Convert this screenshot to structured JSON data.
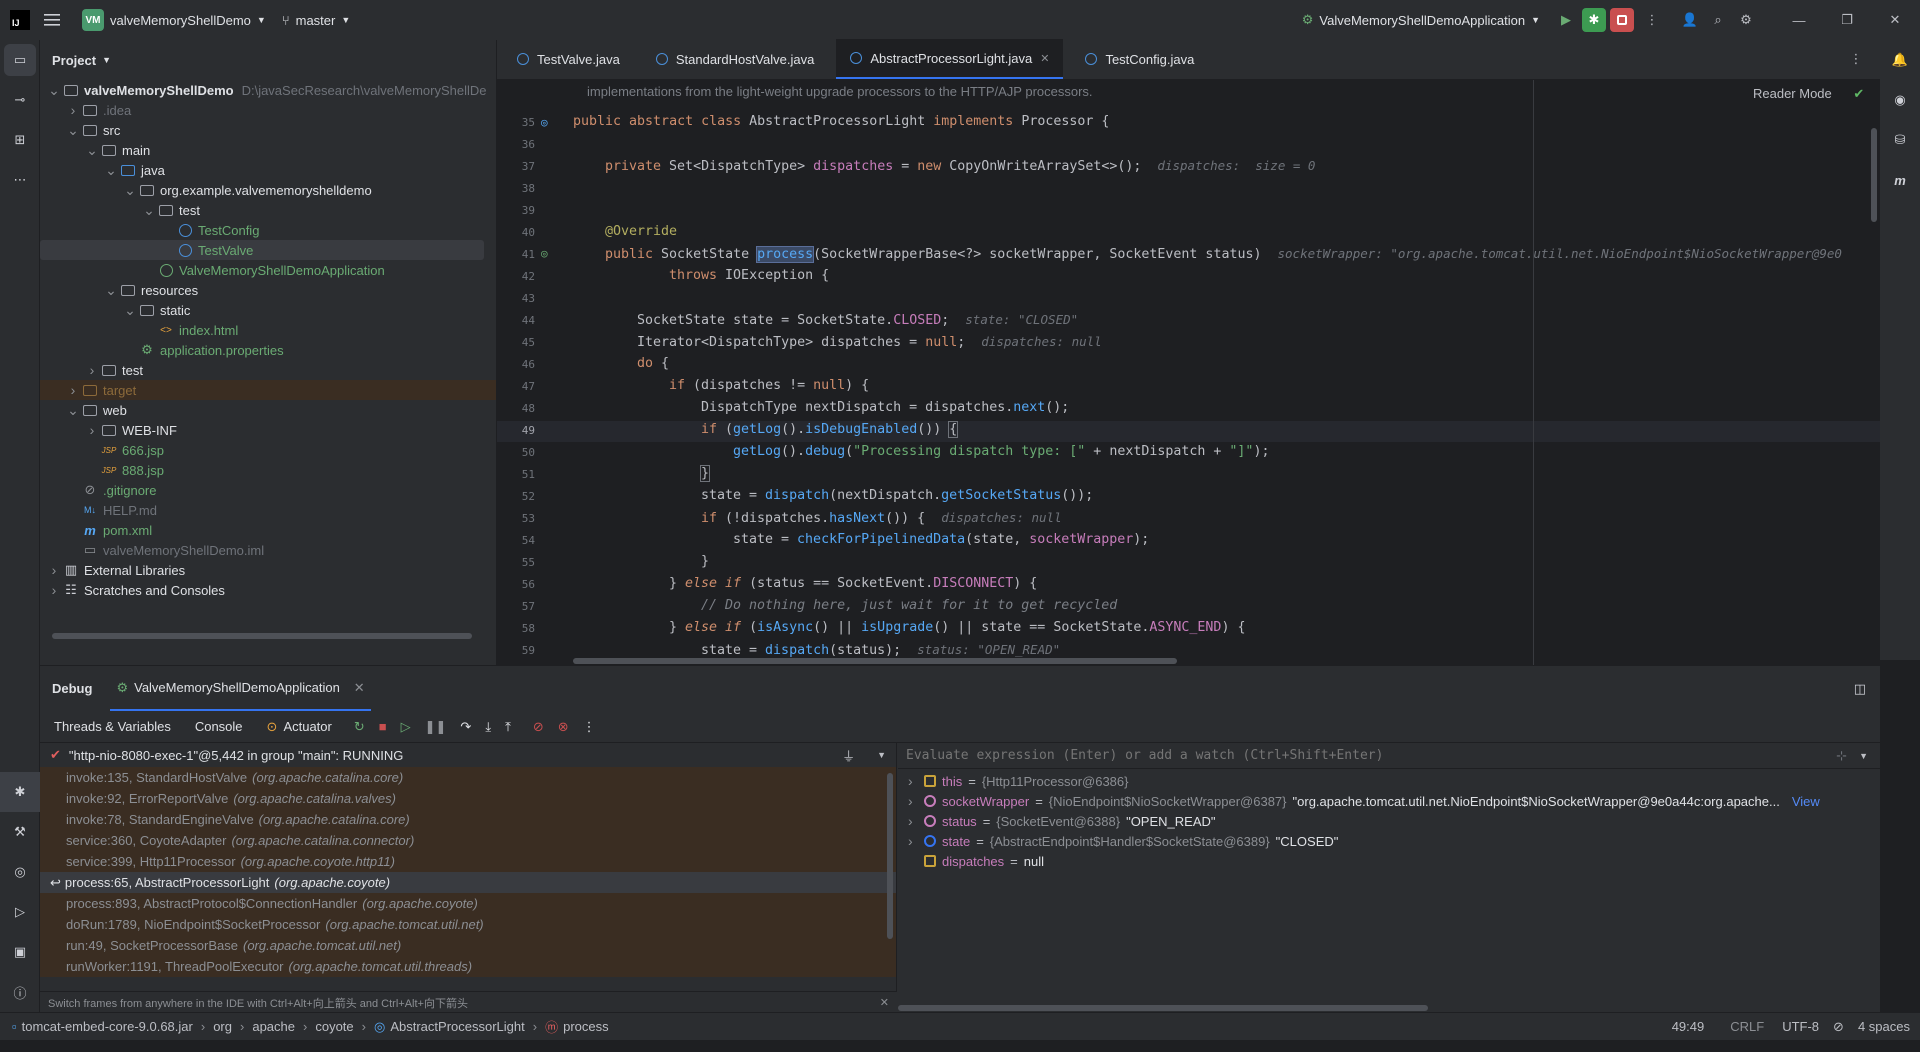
{
  "titlebar": {
    "ide_logo": "IJ",
    "project_badge": "VM",
    "project_name": "valveMemoryShellDemo",
    "branch": "master",
    "run_config": "ValveMemoryShellDemoApplication"
  },
  "project_panel": {
    "title": "Project",
    "tree": [
      {
        "label": "valveMemoryShellDemo",
        "extra": "D:\\javaSecResearch\\valveMemoryShellDe",
        "depth": 0,
        "open": true,
        "icon": "folder-icon",
        "color": "#dfe1e5",
        "bold": true
      },
      {
        "label": ".idea",
        "depth": 1,
        "open": false,
        "icon": "folder-icon",
        "color": "#6f737a"
      },
      {
        "label": "src",
        "depth": 1,
        "open": true,
        "icon": "folder-icon",
        "color": "#dfe1e5"
      },
      {
        "label": "main",
        "depth": 2,
        "open": true,
        "icon": "folder-icon",
        "color": "#dfe1e5"
      },
      {
        "label": "java",
        "depth": 3,
        "open": true,
        "icon": "folder-icon",
        "color": "#dfe1e5"
      },
      {
        "label": "org.example.valvememoryshelldemo",
        "depth": 4,
        "open": true,
        "icon": "package-icon",
        "color": "#dfe1e5"
      },
      {
        "label": "test",
        "depth": 5,
        "open": true,
        "icon": "package-icon",
        "color": "#dfe1e5"
      },
      {
        "label": "TestConfig",
        "depth": 6,
        "icon": "class-icon",
        "color": "#6aab73"
      },
      {
        "label": "TestValve",
        "depth": 6,
        "icon": "class-icon",
        "color": "#6aab73",
        "selected": true
      },
      {
        "label": "ValveMemoryShellDemoApplication",
        "depth": 5,
        "icon": "spring-class-icon",
        "color": "#6aab73"
      },
      {
        "label": "resources",
        "depth": 3,
        "open": true,
        "icon": "folder-icon",
        "color": "#dfe1e5"
      },
      {
        "label": "static",
        "depth": 4,
        "open": true,
        "icon": "folder-icon",
        "color": "#dfe1e5"
      },
      {
        "label": "index.html",
        "depth": 5,
        "icon": "html-icon",
        "color": "#6aab73"
      },
      {
        "label": "application.properties",
        "depth": 4,
        "icon": "properties-icon",
        "color": "#6aab73"
      },
      {
        "label": "test",
        "depth": 2,
        "open": false,
        "icon": "folder-icon",
        "color": "#dfe1e5"
      },
      {
        "label": "target",
        "depth": 1,
        "open": false,
        "icon": "folder-icon",
        "color": "#8c6a3a",
        "highlight": true
      },
      {
        "label": "web",
        "depth": 1,
        "open": true,
        "icon": "folder-icon",
        "color": "#dfe1e5"
      },
      {
        "label": "WEB-INF",
        "depth": 2,
        "open": false,
        "icon": "folder-icon",
        "color": "#dfe1e5"
      },
      {
        "label": "666.jsp",
        "depth": 2,
        "icon": "jsp-icon",
        "color": "#6aab73"
      },
      {
        "label": "888.jsp",
        "depth": 2,
        "icon": "jsp-icon",
        "color": "#6aab73"
      },
      {
        "label": ".gitignore",
        "depth": 1,
        "icon": "gitignore-icon",
        "color": "#6aab73"
      },
      {
        "label": "HELP.md",
        "depth": 1,
        "icon": "markdown-icon",
        "color": "#6f737a"
      },
      {
        "label": "pom.xml",
        "depth": 1,
        "icon": "maven-icon",
        "color": "#6aab73"
      },
      {
        "label": "valveMemoryShellDemo.iml",
        "depth": 1,
        "icon": "iml-icon",
        "color": "#6f737a"
      },
      {
        "label": "External Libraries",
        "depth": 0,
        "open": false,
        "icon": "library-icon",
        "color": "#dfe1e5"
      },
      {
        "label": "Scratches and Consoles",
        "depth": 0,
        "open": false,
        "icon": "scratch-icon",
        "color": "#dfe1e5"
      }
    ]
  },
  "editor": {
    "tabs": [
      {
        "label": "TestValve.java",
        "active": false
      },
      {
        "label": "StandardHostValve.java",
        "active": false
      },
      {
        "label": "AbstractProcessorLight.java",
        "active": true,
        "closable": true
      },
      {
        "label": "TestConfig.java",
        "active": false
      }
    ],
    "reader_mode": "Reader Mode",
    "doc_line": "implementations from the light-weight upgrade processors to the HTTP/AJP processors.",
    "line_numbers": [
      "35",
      "36",
      "37",
      "38",
      "39",
      "40",
      "41",
      "42",
      "43",
      "44",
      "45",
      "46",
      "47",
      "48",
      "49",
      "50",
      "51",
      "52",
      "53",
      "54",
      "55",
      "56",
      "57",
      "58",
      "59"
    ]
  },
  "debug": {
    "title": "Debug",
    "session_tab": "ValveMemoryShellDemoApplication",
    "subtabs": {
      "threads": "Threads & Variables",
      "console": "Console",
      "actuator": "Actuator"
    },
    "thread": "\"http-nio-8080-exec-1\"@5,442 in group \"main\": RUNNING",
    "frames": [
      {
        "method": "invoke:135, StandardHostValve",
        "pkg": "(org.apache.catalina.core)"
      },
      {
        "method": "invoke:92, ErrorReportValve",
        "pkg": "(org.apache.catalina.valves)"
      },
      {
        "method": "invoke:78, StandardEngineValve",
        "pkg": "(org.apache.catalina.core)"
      },
      {
        "method": "service:360, CoyoteAdapter",
        "pkg": "(org.apache.catalina.connector)"
      },
      {
        "method": "service:399, Http11Processor",
        "pkg": "(org.apache.coyote.http11)"
      },
      {
        "method": "process:65, AbstractProcessorLight",
        "pkg": "(org.apache.coyote)",
        "current": true
      },
      {
        "method": "process:893, AbstractProtocol$ConnectionHandler",
        "pkg": "(org.apache.coyote)"
      },
      {
        "method": "doRun:1789, NioEndpoint$SocketProcessor",
        "pkg": "(org.apache.tomcat.util.net)"
      },
      {
        "method": "run:49, SocketProcessorBase",
        "pkg": "(org.apache.tomcat.util.net)"
      },
      {
        "method": "runWorker:1191, ThreadPoolExecutor",
        "pkg": "(org.apache.tomcat.util.threads)"
      }
    ],
    "frames_hint": "Switch frames from anywhere in the IDE with Ctrl+Alt+向上箭头 and Ctrl+Alt+向下箭头",
    "eval_placeholder": "Evaluate expression (Enter) or add a watch (Ctrl+Shift+Enter)",
    "variables": [
      {
        "name": "this",
        "type": "{Http11Processor@6386}",
        "value": "",
        "expandable": true,
        "icon": "field-icon",
        "iconColor": "#c9a33a"
      },
      {
        "name": "socketWrapper",
        "type": "{NioEndpoint$NioSocketWrapper@6387}",
        "value": "\"org.apache.tomcat.util.net.NioEndpoint$NioSocketWrapper@9e0a44c:org.apache...",
        "link": "View",
        "expandable": true,
        "icon": "param-icon",
        "iconColor": "#c77dbb"
      },
      {
        "name": "status",
        "type": "{SocketEvent@6388}",
        "value": "\"OPEN_READ\"",
        "expandable": true,
        "icon": "param-icon",
        "iconColor": "#c77dbb"
      },
      {
        "name": "state",
        "type": "{AbstractEndpoint$Handler$SocketState@6389}",
        "value": "\"CLOSED\"",
        "expandable": true,
        "icon": "enum-icon",
        "iconColor": "#3574f0"
      },
      {
        "name": "dispatches",
        "type": "",
        "value": "null",
        "expandable": false,
        "icon": "field-icon",
        "iconColor": "#c9a33a"
      }
    ]
  },
  "statusbar": {
    "breadcrumb": [
      "tomcat-embed-core-9.0.68.jar",
      "org",
      "apache",
      "coyote",
      "AbstractProcessorLight",
      "process"
    ],
    "position": "49:49",
    "line_sep": "CRLF",
    "encoding": "UTF-8",
    "indent": "4 spaces"
  }
}
